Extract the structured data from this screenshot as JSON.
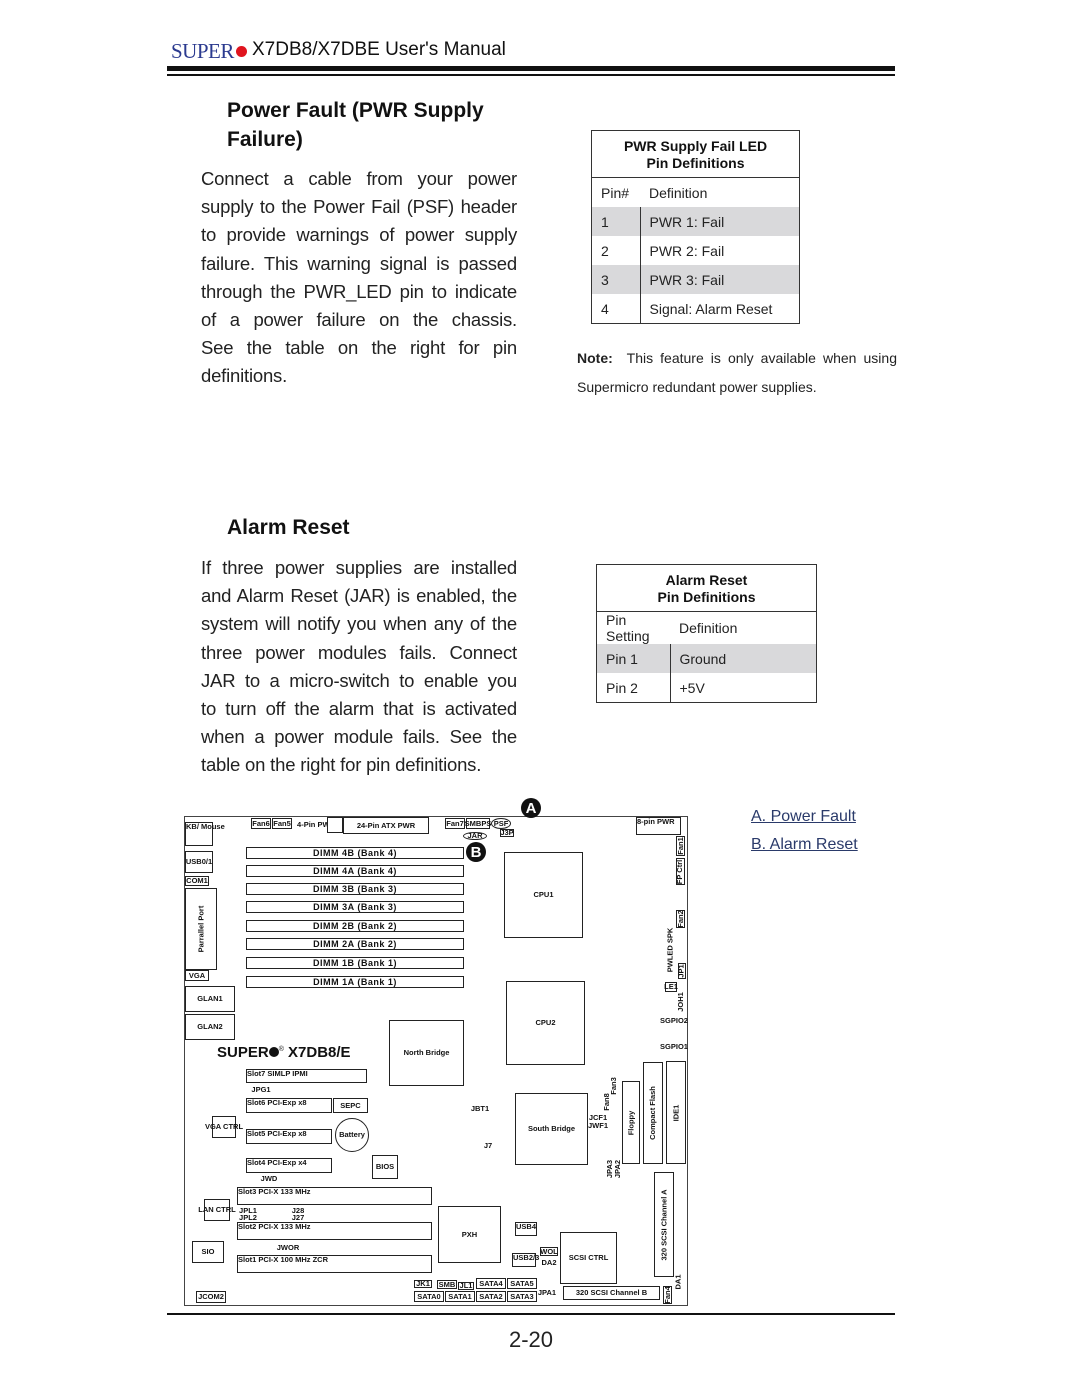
{
  "header": {
    "brand": "SUPER",
    "title": "X7DB8/X7DBE User's Manual"
  },
  "power_fault": {
    "heading_lines": [
      "Power Fault (PWR Supply",
      "Failure)"
    ],
    "body_lines": [
      "Connect a cable from your power",
      "supply to the Power Fail (PSF) header",
      "to provide warnings of power supply",
      "failure. This warning signal is passed",
      "through the PWR_LED pin to indicate",
      "of a power failure on the chassis.",
      "See the table on the right for pin",
      "definitions."
    ],
    "table": {
      "title_lines": [
        "PWR Supply Fail LED",
        "Pin Definitions"
      ],
      "columns": [
        "Pin#",
        "Definition"
      ],
      "rows": [
        [
          "1",
          "PWR 1: Fail"
        ],
        [
          "2",
          "PWR 2: Fail"
        ],
        [
          "3",
          "PWR 3: Fail"
        ],
        [
          "4",
          "Signal: Alarm Reset"
        ]
      ]
    },
    "note_label": "Note:",
    "note_lines": [
      "This feature is only available when using",
      "Supermicro redundant  power supplies."
    ]
  },
  "alarm_reset": {
    "heading": "Alarm Reset",
    "body_lines": [
      "If three power supplies are installed",
      "and Alarm Reset (JAR) is enabled, the",
      "system will notify you when any of the",
      "three power modules fails. Connect",
      "JAR to a micro-switch to enable you",
      "to turn off the alarm that is activated",
      "when a power module fails. See the",
      "table on the right for pin definitions."
    ],
    "table": {
      "title_lines": [
        "Alarm Reset",
        "Pin Definitions"
      ],
      "columns": [
        "Pin Setting",
        "Definition"
      ],
      "rows": [
        [
          "Pin 1",
          "Ground"
        ],
        [
          "Pin 2",
          "+5V"
        ]
      ]
    }
  },
  "legend_links": [
    "A. Power Fault",
    "B. Alarm Reset"
  ],
  "board": {
    "markers": [
      "A",
      "B"
    ],
    "brand": "SUPER",
    "model": "X7DB8/E",
    "components": [
      "KB/ Mouse",
      "USB0/1",
      "COM1",
      "Parrallel Port",
      "VGA",
      "GLAN1",
      "GLAN2",
      "Fan6",
      "Fan5",
      "4-Pin PWR",
      "",
      "24-Pin ATX PWR",
      "Fan7",
      "SMBPS",
      "PSF",
      "J3P",
      "JAR",
      "DIMM  4B  (Bank  4)",
      "DIMM  4A  (Bank  4)",
      "DIMM  3B  (Bank  3)",
      "DIMM  3A  (Bank  3)",
      "DIMM  2B  (Bank  2)",
      "DIMM  2A  (Bank  2)",
      "DIMM  1B  (Bank  1)",
      "DIMM  1A  (Bank  1)",
      "CPU1",
      "CPU2",
      "8-pin PWR",
      "Fan1",
      "FP Ctrl",
      "Fan2",
      "PWLED SPK",
      "JP1",
      "LE1",
      "JOH1",
      "SGPIO2",
      "SGPIO1",
      "North Bridge",
      "Slot7   SIMLP IPMI",
      "JPG1",
      "Slot6   PCI-Exp  x8",
      "SEPC",
      "VGA CTRL",
      "Slot5   PCI-Exp  x8",
      "Battery",
      "Slot4   PCI-Exp  x4",
      "BIOS",
      "JWD",
      "Slot3   PCI-X 133 MHz",
      "LAN CTRL",
      "JPL1",
      "JPL2",
      "J28",
      "J27",
      "Slot2   PCI-X 133 MHz",
      "SIO",
      "JWOR",
      "Slot1   PCI-X 100 MHz  ZCR",
      "JCOM2",
      "PXH",
      "JBT1",
      "J7",
      "South Bridge",
      "Fan8",
      "Fan3",
      "Floppy",
      "Compact Flash",
      "IDE1",
      "JCF1",
      "JWF1",
      "JPA3",
      "JPA2",
      "320 SCSI  Channel  A",
      "SCSI CTRL",
      "USB4",
      "USB2/3",
      "WOL",
      "DA2",
      "320 SCSI  Channel  B",
      "Fan4",
      "DA1",
      "JK1",
      "SMB",
      "JL1",
      "SATA4",
      "SATA5",
      "SATA0",
      "SATA1",
      "SATA2",
      "SATA3",
      "JPA1"
    ]
  },
  "page_number": "2-20"
}
